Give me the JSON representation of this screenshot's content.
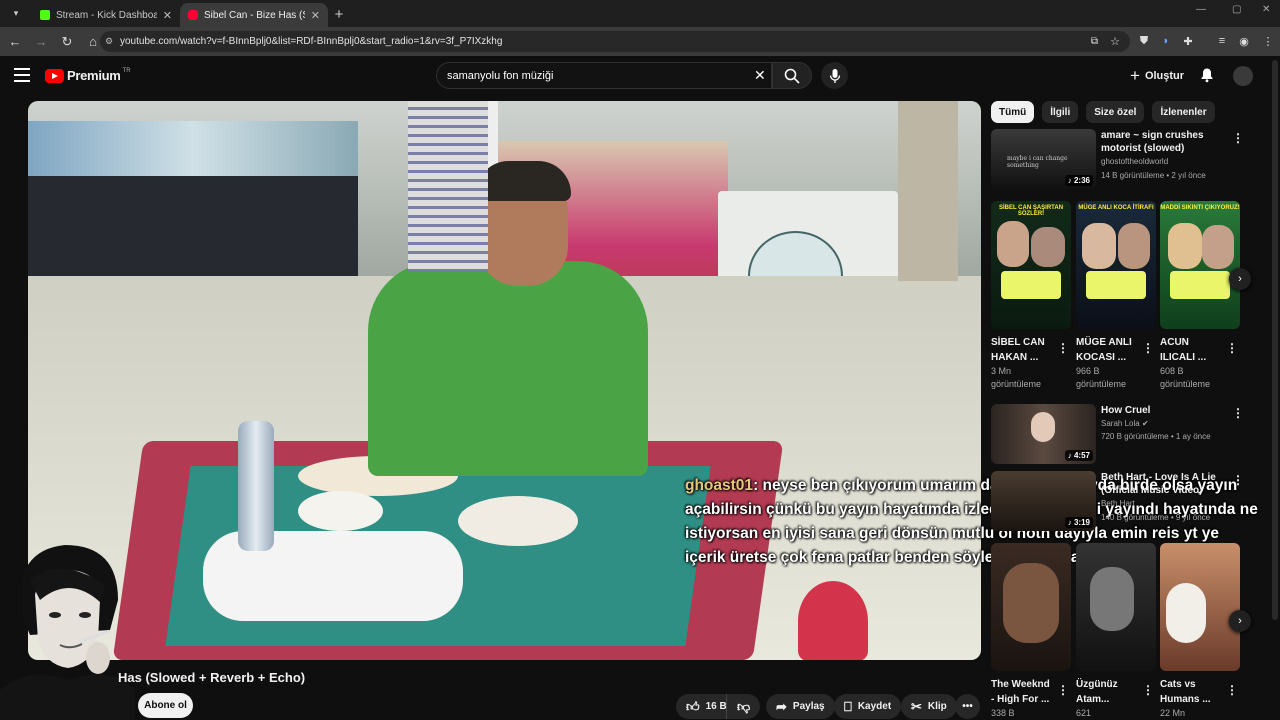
{
  "browser": {
    "tabs": [
      {
        "title": "Stream - Kick Dashboard",
        "color": "#53fc18"
      },
      {
        "title": "Sibel Can - Bize Has (Slowed +",
        "color": "#ff0033"
      }
    ],
    "url": "youtube.com/watch?v=f-BInnBplj0&list=RDf-BInnBplj0&start_radio=1&rv=3f_P7IXzkhg"
  },
  "youtube": {
    "logo": "Premium",
    "logo_sup": "TR",
    "search_query": "samanyolu fon müziği",
    "create_label": "Oluştur"
  },
  "video": {
    "title": "Has (Slowed + Reverb + Echo)",
    "subscribe_label": "Abone ol",
    "likes": "16 B",
    "share_label": "Paylaş",
    "save_label": "Kaydet",
    "clip_label": "Klip"
  },
  "chat": {
    "user": "ghoast01",
    "message": ": neyse ben çıkıyorum umarım daha sonra 2 ayda birde olsa yayın açabilirsin çünkü bu yayın hayatımda izlediğim en keyifli yayındı hayatında ne istiyorsan en iyisi sana geri dönsün mutlu ol noth dayıyla emin reis yt ye içerik üretse çok fena patlar benden söylemesi bu arada"
  },
  "chips": [
    "Tümü",
    "İlgili",
    "Size özel",
    "İzlenenler"
  ],
  "recs": [
    {
      "title": "amare ~ sign crushes motorist (slowed)",
      "channel": "ghostoftheoldworld",
      "meta": "14 B görüntüleme • 2 yıl önce",
      "duration": "2:36",
      "thumb_text": "maybe i can change something"
    },
    {
      "title": "How Cruel",
      "channel": "Sarah Lola",
      "meta": "720 B görüntüleme • 1 ay önce",
      "duration": "4:57"
    },
    {
      "title": "Beth Hart - Love Is A Lie (Official Music Video)",
      "channel": "Beth Hart",
      "meta": "140 B görüntüleme • 9 yıl önce",
      "duration": "3:19"
    }
  ],
  "shorts1": [
    {
      "title": "SİBEL CAN HAKAN ...",
      "views": "3 Mn görüntüleme",
      "banner": "SİBEL CAN ŞAŞIRTAN SÖZLER!"
    },
    {
      "title": "MÜGE ANLI KOCASI ...",
      "views": "966 B görüntüleme",
      "banner": "MÜGE ANLI KOCA İTİRAFI"
    },
    {
      "title": "ACUN ILICALI ...",
      "views": "608 B görüntüleme",
      "banner": "MADDİ SIKINTI ÇIKIYORUZ!"
    }
  ],
  "shorts2": [
    {
      "title": "The Weeknd - High For ...",
      "views": "338 B"
    },
    {
      "title": "Üzgünüz Atam...",
      "views": "621"
    },
    {
      "title": "Cats vs Humans ...",
      "views": "22 Mn"
    }
  ],
  "colors": {
    "accent": "#ff0000",
    "bg": "#0f0f0f",
    "chat_user": "#e7c77a"
  }
}
